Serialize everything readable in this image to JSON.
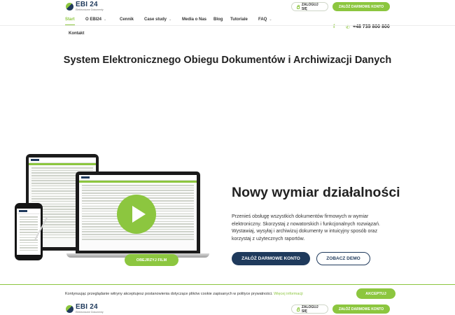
{
  "header": {
    "logo_name": "EBI 24",
    "logo_subtitle": "Elektroniczne Dokumenty",
    "login_label": "ZALOGUJ SIĘ",
    "signup_label": "ZAŁÓŻ DARMOWE KONTO"
  },
  "nav": {
    "items": [
      "Start",
      "O EBI24",
      "Cennik",
      "Case study",
      "Media o Nas",
      "Blog",
      "Tutoriale",
      "FAQ",
      "Kontakt"
    ],
    "active": "Start",
    "phone": "+48 735 800 800",
    "facebook_icon": "f"
  },
  "hero": {
    "title": "System Elektronicznego Obiegu Dokumentów i Archiwizacji Danych",
    "headline": "Nowy wymiar działalności",
    "description": "Przenieś obsługę wszystkich dokumentów firmowych w wymiar elektroniczny. Skorzystaj z nowatorskich i funkcjonalnych rozwiązań. Wystawiaj, wysyłaj i archiwizuj dokumenty w intuicyjny sposób oraz korzystaj z użytecznych raportów.",
    "film_label": "OBEJRZYJ FILM",
    "signup_label": "ZAŁÓŻ DARMOWE KONTO",
    "demo_label": "ZOBACZ DEMO"
  },
  "cookie": {
    "text": "Kontynuując przeglądanie witryny akceptujesz postanowienia dotyczące plików cookie zapisanych w polityce prywatności.",
    "link": "Więcej informacji",
    "accept_label": "AKCEPTUJ"
  },
  "footer_header": {
    "logo_name": "EBI 24",
    "logo_subtitle": "Elektroniczne Dokumenty",
    "login_label": "ZALOGUJ SIĘ",
    "signup_label": "ZAŁÓŻ DARMOWE KONTO"
  },
  "colors": {
    "accent": "#8cc63f",
    "navy": "#1f3a5c"
  },
  "icons": [
    "lock-icon",
    "facebook-icon",
    "phone-icon",
    "chevron-down-icon",
    "play-icon"
  ]
}
